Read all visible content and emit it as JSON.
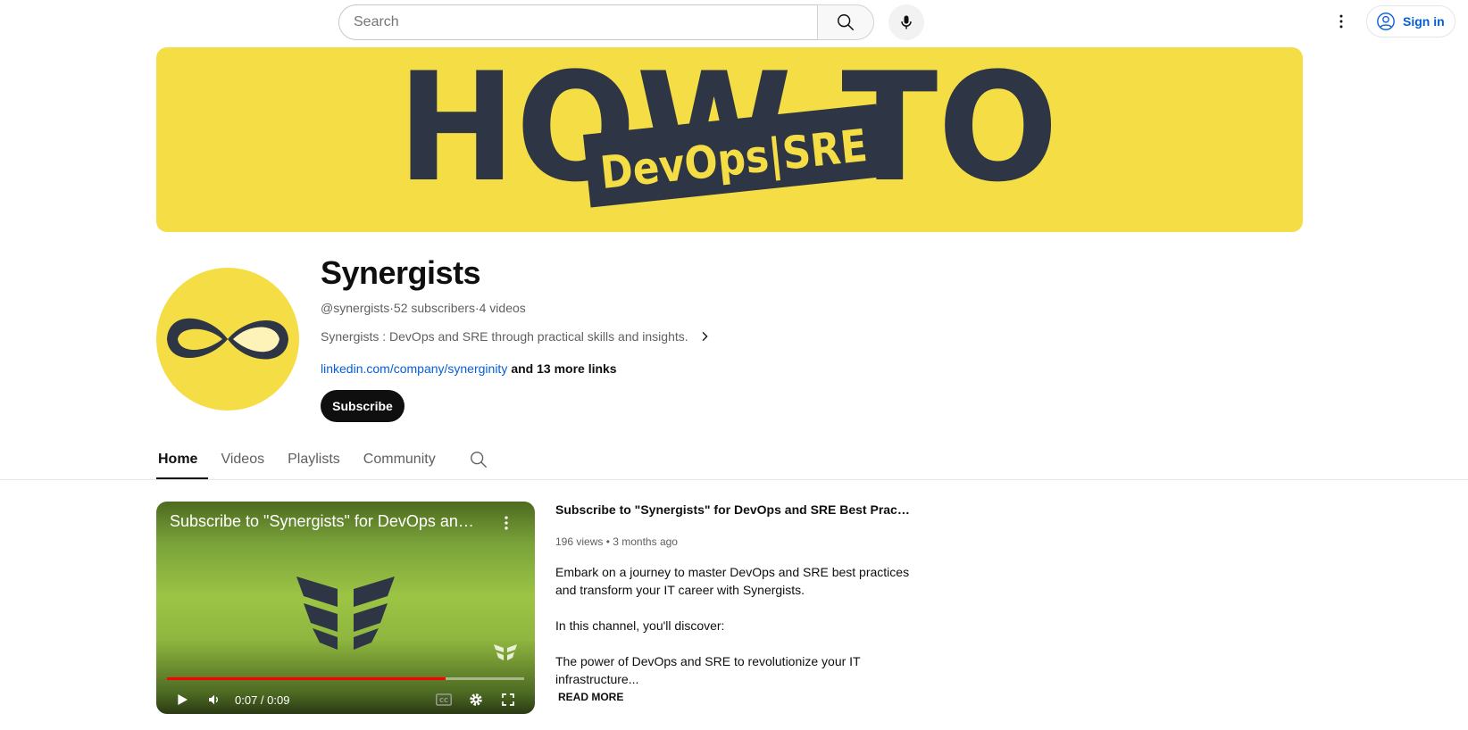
{
  "header": {
    "search_placeholder": "Search",
    "signin_label": "Sign in"
  },
  "banner": {
    "line1": "HOW TO",
    "line2": "DevOps|SRE",
    "bg_color": "#f4dd45",
    "ink_color": "#2e3545"
  },
  "channel": {
    "name": "Synergists",
    "handle": "@synergists",
    "subscribers": "52 subscribers",
    "videos": "4 videos",
    "separator": " · ",
    "description": "Synergists : DevOps and SRE through practical skills and insights.",
    "link_main": "linkedin.com/company/synerginity",
    "link_more": "and 13 more links",
    "subscribe_label": "Subscribe"
  },
  "tabs": [
    {
      "label": "Home",
      "active": true
    },
    {
      "label": "Videos",
      "active": false
    },
    {
      "label": "Playlists",
      "active": false
    },
    {
      "label": "Community",
      "active": false
    }
  ],
  "player": {
    "title": "Subscribe to \"Synergists\" for DevOps and SRE Best Practices : ...",
    "time": "0:07 / 0:09",
    "progress": 0.78
  },
  "featured": {
    "title": "Subscribe to \"Synergists\" for DevOps and SRE Best Practices :...",
    "views": "196 views",
    "age": "3 months ago",
    "meta_sep": " • ",
    "desc_p1": "Embark on a journey to master DevOps and SRE best practices and transform your IT career with Synergists.",
    "desc_p2": "In this channel, you'll discover:",
    "desc_p3": "The power of DevOps and SRE to revolutionize your IT infrastructure...",
    "read_more": "READ MORE"
  },
  "icons": {
    "search": "search-icon",
    "mic": "mic-icon",
    "more": "more-vert-icon",
    "account": "account-circle-icon",
    "chevron": "chevron-right-icon"
  }
}
